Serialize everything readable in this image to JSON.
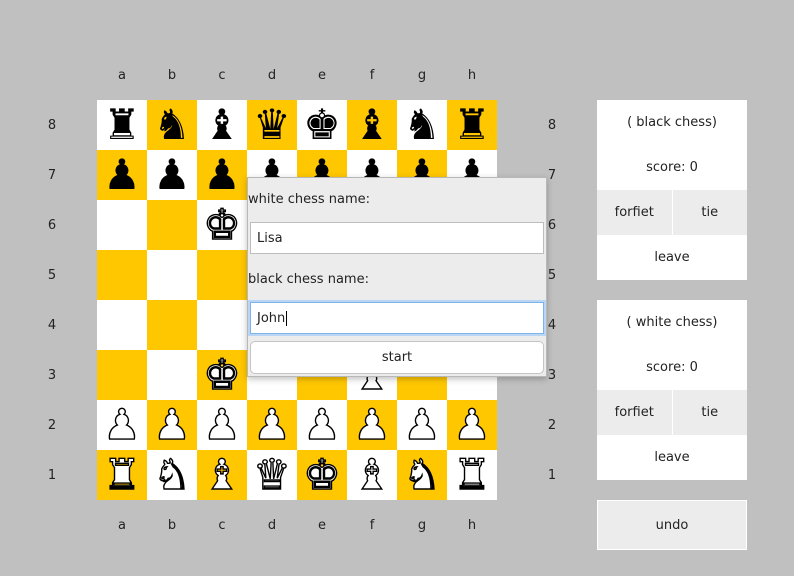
{
  "files": [
    "a",
    "b",
    "c",
    "d",
    "e",
    "f",
    "g",
    "h"
  ],
  "ranks": [
    "8",
    "7",
    "6",
    "5",
    "4",
    "3",
    "2",
    "1"
  ],
  "colors": {
    "light_square": "#ffffff",
    "dark_square": "#ffc700",
    "background": "#c0c0c0"
  },
  "board": [
    [
      "br",
      "bn",
      "bb",
      "bq",
      "bk",
      "bb",
      "bn",
      "br"
    ],
    [
      "bp",
      "bp",
      "bp",
      "bp",
      "bp",
      "bp",
      "bp",
      "bp"
    ],
    [
      "",
      "",
      "wk",
      "",
      "",
      "",
      "",
      ""
    ],
    [
      "",
      "",
      "",
      "",
      "",
      "",
      "",
      ""
    ],
    [
      "",
      "",
      "",
      "",
      "",
      "",
      "",
      ""
    ],
    [
      "",
      "",
      "wk",
      "",
      "",
      "wb",
      "",
      ""
    ],
    [
      "wp",
      "wp",
      "wp",
      "wp",
      "wp",
      "wp",
      "wp",
      "wp"
    ],
    [
      "wr",
      "wn",
      "wb",
      "wq",
      "wk",
      "wb",
      "wn",
      "wr"
    ]
  ],
  "piece_glyphs": {
    "k": "♚",
    "q": "♛",
    "r": "♜",
    "b": "♝",
    "n": "♞",
    "p": "♟"
  },
  "black_panel": {
    "title": "( black chess)",
    "score": "score: 0",
    "forfeit_label": "forfiet",
    "tie_label": "tie",
    "leave_label": "leave"
  },
  "white_panel": {
    "title": "( white chess)",
    "score": "score: 0",
    "forfeit_label": "forfiet",
    "tie_label": "tie",
    "leave_label": "leave"
  },
  "undo_label": "undo",
  "dialog": {
    "white_label": "white chess name:",
    "white_value": "Lisa",
    "black_label": "black chess name:",
    "black_value": "John",
    "start_label": "start"
  }
}
